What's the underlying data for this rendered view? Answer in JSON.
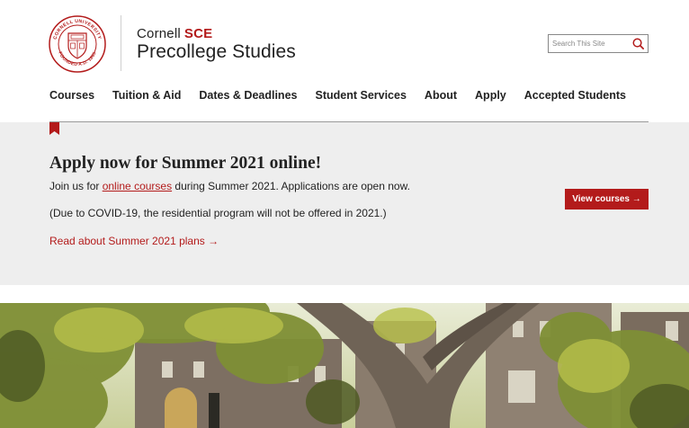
{
  "header": {
    "seal_text_top": "CORNELL UNIVERSITY",
    "seal_text_bottom": "FOUNDED A.D. 1865",
    "brand_prefix": "Cornell",
    "brand_accent": "SCE",
    "brand_title": "Precollege Studies"
  },
  "search": {
    "placeholder": "Search This Site",
    "value": "",
    "icon": "search-icon"
  },
  "nav": {
    "items": [
      {
        "label": "Courses"
      },
      {
        "label": "Tuition & Aid"
      },
      {
        "label": "Dates & Deadlines"
      },
      {
        "label": "Student Services"
      },
      {
        "label": "About"
      },
      {
        "label": "Apply"
      },
      {
        "label": "Accepted Students"
      }
    ]
  },
  "alert": {
    "icon": "bookmark-icon",
    "title": "Apply now for Summer 2021 online!",
    "p1_before": "Join us for ",
    "p1_link": "online courses",
    "p1_after": " during Summer 2021. Applications are open now.",
    "p2": "(Due to COVID-19, the residential program will not be offered in 2021.)",
    "read_link": "Read about Summer 2021 plans →",
    "button": "View courses →"
  },
  "colors": {
    "accent": "#b31b1b",
    "alert_bg": "#eeeeee",
    "text": "#222222"
  },
  "hero": {
    "alt": "Campus courtyard with trees and stone buildings",
    "icon": "campus-photo"
  }
}
